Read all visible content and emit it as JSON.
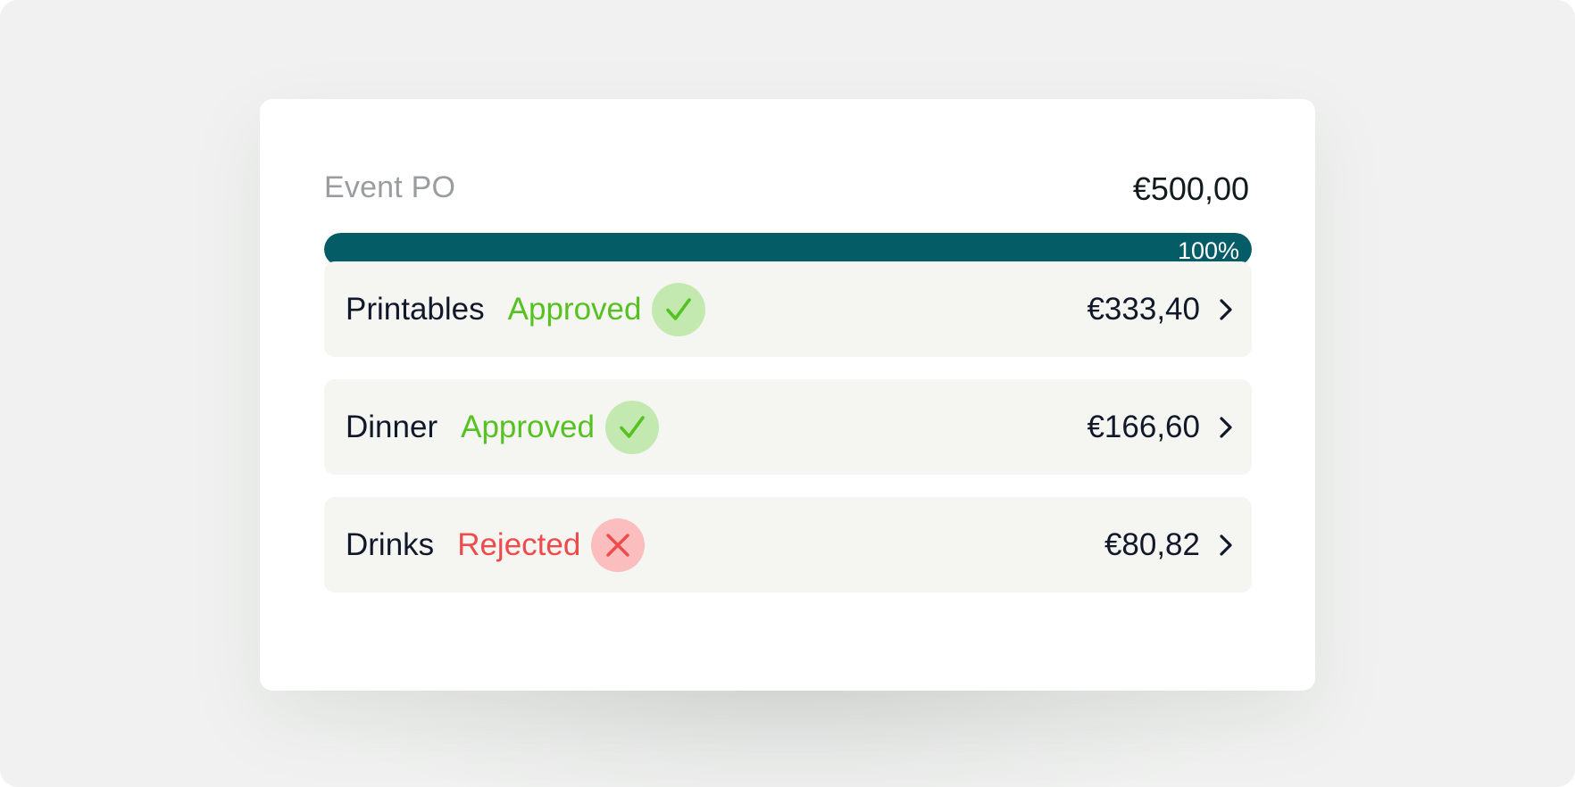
{
  "colors": {
    "accent": "#045c66",
    "approved": "#55c222",
    "rejected": "#ee4b4b",
    "approved_badge_bg": "#c3e9b1",
    "rejected_badge_bg": "#fbbdbd"
  },
  "header": {
    "title": "Event PO",
    "amount": "€500,00"
  },
  "progress": {
    "value_percent": 100,
    "label": "100%"
  },
  "items": [
    {
      "name": "Printables",
      "status": "Approved",
      "status_icon": "check-icon",
      "amount": "€333,40",
      "chevron": "chevron-right-icon"
    },
    {
      "name": "Dinner",
      "status": "Approved",
      "status_icon": "check-icon",
      "amount": "€166,60",
      "chevron": "chevron-right-icon"
    },
    {
      "name": "Drinks",
      "status": "Rejected",
      "status_icon": "close-icon",
      "amount": "€80,82",
      "chevron": "chevron-right-icon"
    }
  ]
}
